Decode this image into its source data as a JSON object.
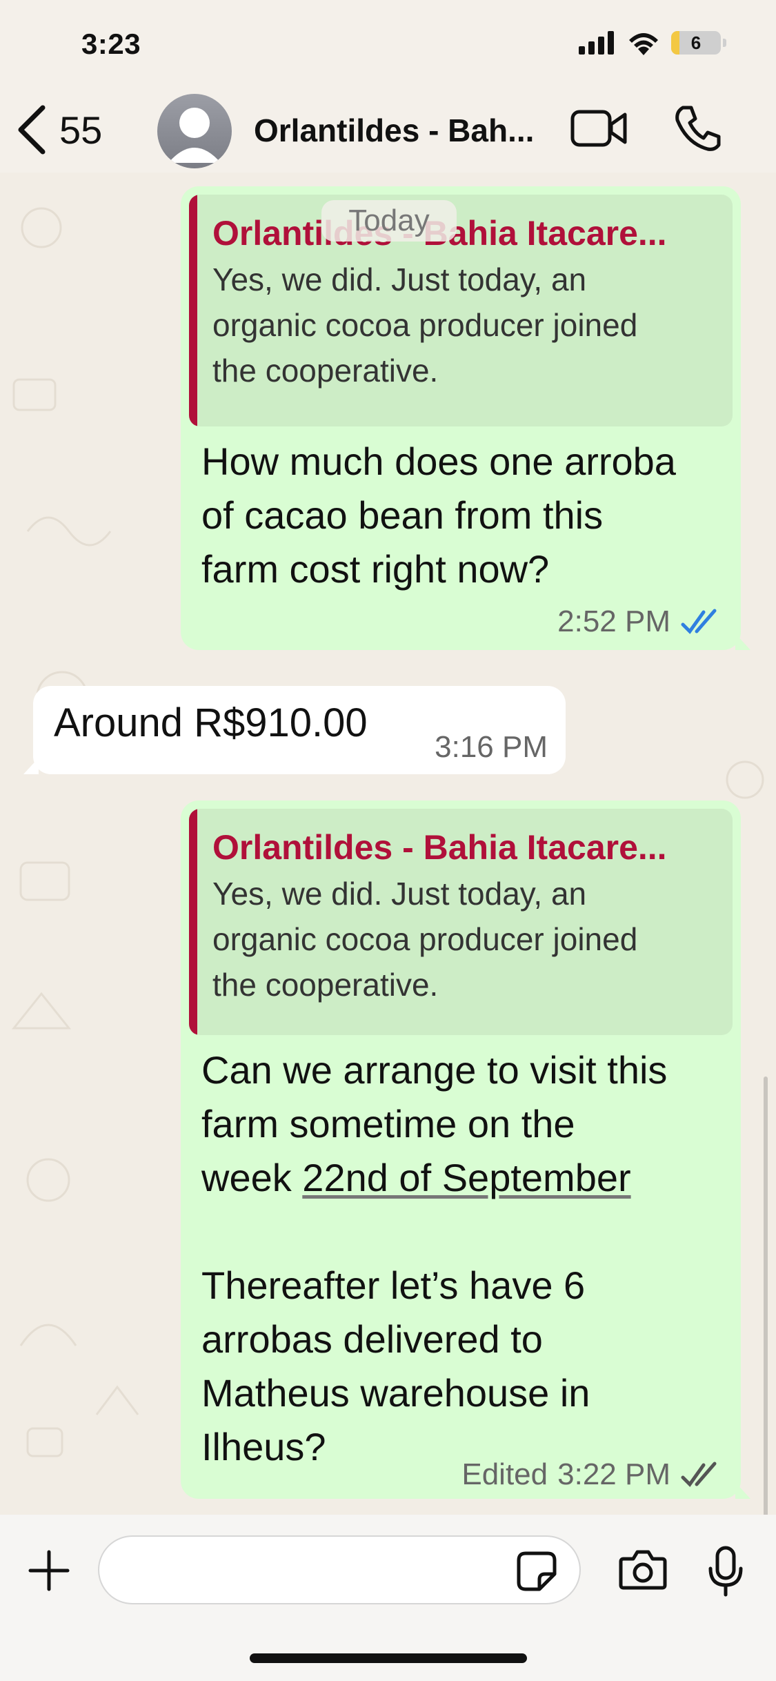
{
  "status_bar": {
    "time": "3:23",
    "battery_level": "6",
    "icons": [
      "signal-icon",
      "wifi-icon",
      "battery-icon"
    ]
  },
  "header": {
    "back_count": "55",
    "contact_name": "Orlantildes - Bah...",
    "icons": [
      "chevron-left-icon",
      "avatar",
      "video-call-icon",
      "phone-icon"
    ]
  },
  "chat": {
    "date_chip": "Today",
    "messages": [
      {
        "direction": "outgoing",
        "quote": {
          "name": "Orlantildes - Bahia Itacare...",
          "lines": [
            "Yes, we did. Just today, an",
            "organic cocoa producer joined",
            "the cooperative."
          ]
        },
        "lines": [
          "How much does one arroba",
          "of cacao bean from this",
          "farm cost right now?"
        ],
        "time": "2:52 PM",
        "read_status": "read"
      },
      {
        "direction": "incoming",
        "text": "Around R$910.00",
        "time": "3:16 PM"
      },
      {
        "direction": "outgoing",
        "quote": {
          "name": "Orlantildes - Bahia Itacare...",
          "lines": [
            "Yes, we did. Just today, an",
            "organic cocoa producer joined",
            "the cooperative."
          ]
        },
        "lines": [
          "Can we arrange to visit this",
          "farm sometime on the",
          "week ",
          "22nd of September",
          "Thereafter let’s have 6",
          "arrobas delivered to",
          "Matheus warehouse in",
          "Ilheus?"
        ],
        "edited_label": "Edited",
        "time": "3:22 PM",
        "read_status": "delivered"
      }
    ]
  },
  "input_bar": {
    "placeholder": "",
    "icons": [
      "plus-icon",
      "sticker-icon",
      "camera-icon",
      "microphone-icon"
    ]
  },
  "colors": {
    "outgoing_bubble": "#d9fdd3",
    "quote_accent": "#b0103a",
    "read_tick": "#2f7fe0",
    "chat_bg": "#f2ede5"
  }
}
